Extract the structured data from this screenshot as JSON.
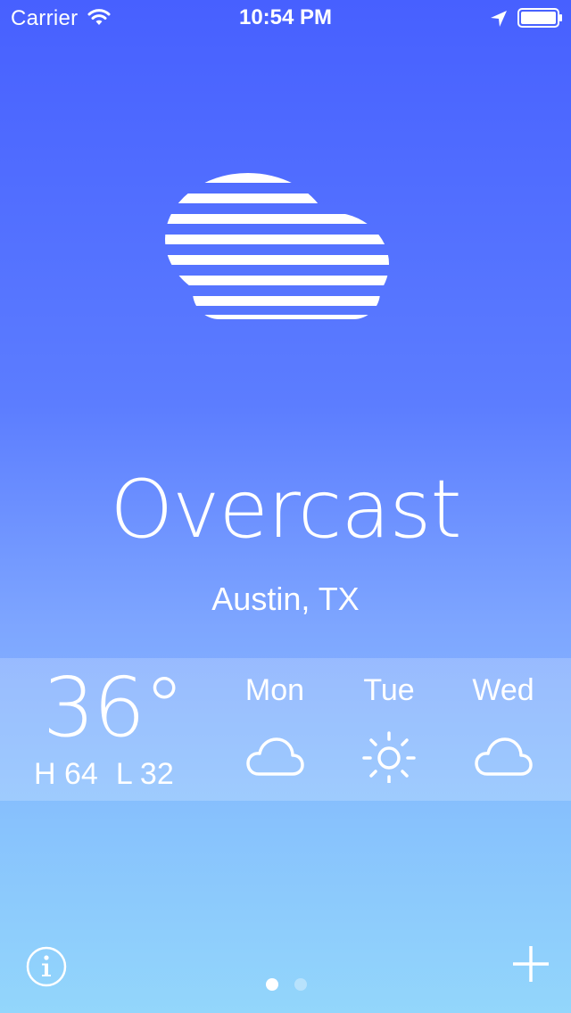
{
  "status_bar": {
    "carrier": "Carrier",
    "time": "10:54 PM",
    "icons": [
      "wifi-icon",
      "location-arrow-icon",
      "battery-icon"
    ]
  },
  "current": {
    "condition": "Overcast",
    "location": "Austin, TX",
    "icon": "overcast-cloud-icon",
    "temperature": "36°",
    "high": "H 64",
    "low": "L 32"
  },
  "forecast": [
    {
      "day": "Mon",
      "icon": "cloud-icon"
    },
    {
      "day": "Tue",
      "icon": "sun-icon"
    },
    {
      "day": "Wed",
      "icon": "cloud-icon"
    }
  ],
  "pager": {
    "pages": 2,
    "active_index": 0
  },
  "controls": {
    "info_icon": "info-icon",
    "add_icon": "plus-icon"
  },
  "colors": {
    "gradient_top": "#4760ff",
    "gradient_bottom": "#93d6fb",
    "text": "#ffffff"
  }
}
